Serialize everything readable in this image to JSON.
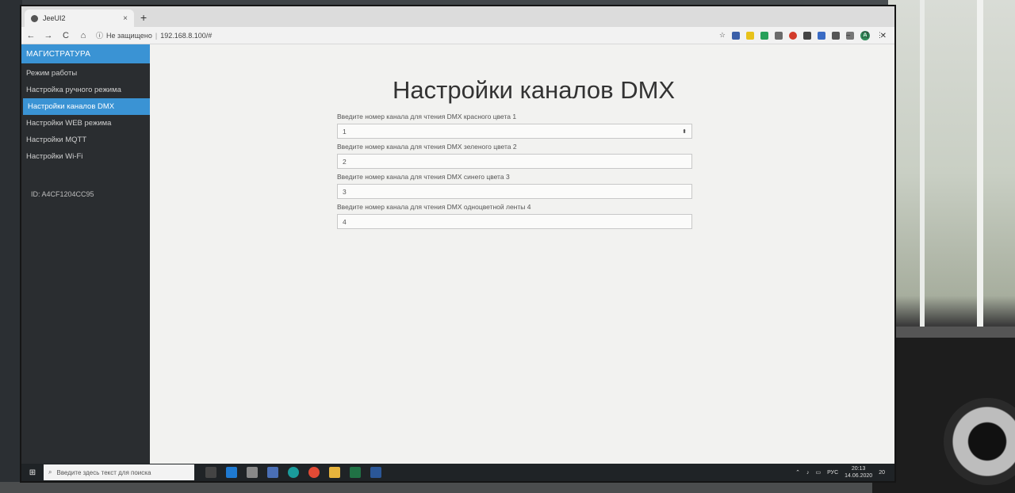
{
  "browser": {
    "tab_title": "JeeUI2",
    "tab_close": "×",
    "new_tab": "+",
    "nav_back": "←",
    "nav_forward": "→",
    "nav_reload": "C",
    "nav_home": "⌂",
    "security_label": "Не защищено",
    "url_separator": "|",
    "url": "192.168.8.100/#",
    "bookmark_icon": "☆",
    "menu_icon": "⋮",
    "profile_initial": "A",
    "window_minimize": "−",
    "window_restore": "❐",
    "window_close": "✕"
  },
  "sidebar": {
    "brand": "МАГИСТРАТУРА",
    "items": [
      {
        "label": "Режим работы",
        "active": false
      },
      {
        "label": "Настройка ручного режима",
        "active": false
      },
      {
        "label": "Настройки каналов DMX",
        "active": true
      },
      {
        "label": "Настройки WEB режима",
        "active": false
      },
      {
        "label": "Настройки MQTT",
        "active": false
      },
      {
        "label": "Настройки Wi-Fi",
        "active": false
      }
    ],
    "device_id": "ID: A4CF1204CC95"
  },
  "main": {
    "title": "Настройки каналов DMX",
    "fields": [
      {
        "label": "Введите номер канала для чтения DMX красного цвета 1",
        "value": "1"
      },
      {
        "label": "Введите номер канала для чтения DMX зеленого цвета 2",
        "value": "2"
      },
      {
        "label": "Введите номер канала для чтения DMX синего цвета 3",
        "value": "3"
      },
      {
        "label": "Введите номер канала для чтения DMX одноцветной ленты 4",
        "value": "4"
      }
    ]
  },
  "taskbar": {
    "search_placeholder": "Введите здесь текст для поиска",
    "language": "РУС",
    "time": "20:13",
    "date": "14.06.2020",
    "notification_count": "20"
  },
  "colors": {
    "accent": "#3a93d4",
    "sidebar_bg": "#2a2d30",
    "content_bg": "#f2f2f0"
  }
}
